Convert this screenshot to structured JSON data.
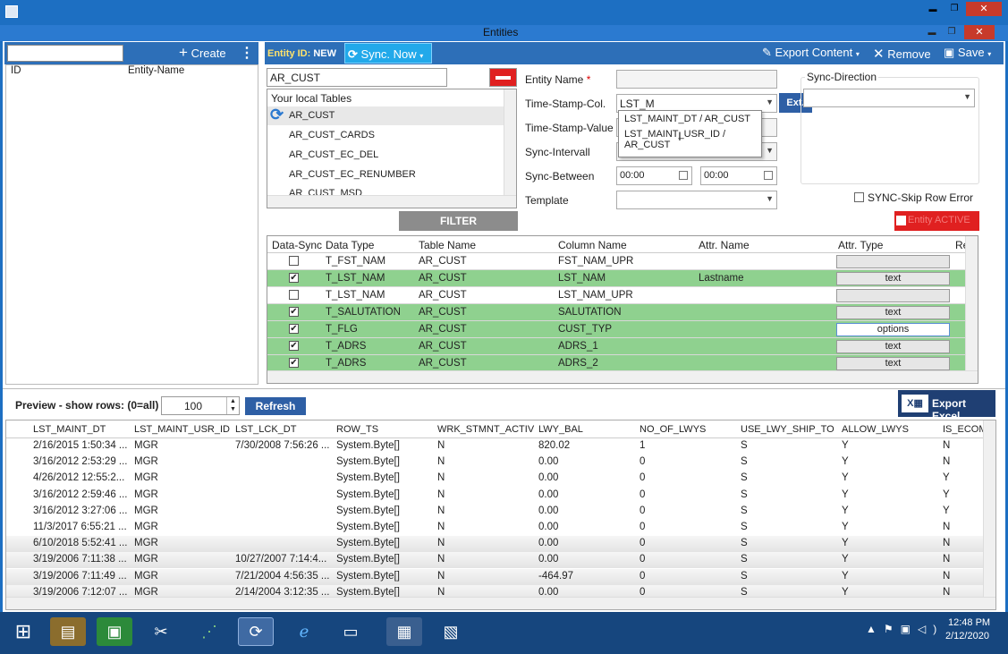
{
  "window": {
    "title": "Entities",
    "min": "▬",
    "restore": "❐",
    "close": "✕"
  },
  "sidebar": {
    "create_label": "Create",
    "col_id": "ID",
    "col_name": "Entity-Name"
  },
  "toolbar": {
    "entity_id_label": "Entity ID:",
    "entity_id_value": "NEW",
    "sync_now_label": "Sync. Now",
    "export_content_label": "Export Content",
    "remove_label": "Remove",
    "save_label": "Save"
  },
  "table_select": {
    "search_value": "AR_CUST",
    "list_header": "Your local Tables",
    "items": [
      "AR_CUST",
      "AR_CUST_CARDS",
      "AR_CUST_EC_DEL",
      "AR_CUST_EC_RENUMBER",
      "AR_CUST_MSD"
    ],
    "filter_label": "FILTER"
  },
  "form": {
    "entity_name_label": "Entity Name",
    "timestamp_col_label": "Time-Stamp-Col.",
    "timestamp_col_value": "LST_M",
    "ext_label": "Ext.",
    "timestamp_value_label": "Time-Stamp-Value",
    "sync_interval_label": "Sync-Intervall",
    "sync_between_label": "Sync-Between",
    "sync_from": "00:00",
    "sync_to": "00:00",
    "template_label": "Template",
    "dropdown_options": [
      "LST_MAINT_DT / AR_CUST",
      "LST_MAINT_USR_ID / AR_CUST"
    ]
  },
  "sync_direction": {
    "label": "Sync-Direction",
    "skip_error_label": "SYNC-Skip Row Error",
    "entity_active_label": "Entity ACTIVE"
  },
  "mapping": {
    "headers": [
      "Data-Sync",
      "Data Type",
      "Table Name",
      "Column Name",
      "Attr. Name",
      "Attr. Type",
      "Re"
    ],
    "rows": [
      {
        "checked": "",
        "type": "T_FST_NAM",
        "table": "AR_CUST",
        "column": "FST_NAM_UPR",
        "attr_name": "",
        "attr_type": ""
      },
      {
        "checked": "✔",
        "type": "T_LST_NAM",
        "table": "AR_CUST",
        "column": "LST_NAM",
        "attr_name": "Lastname",
        "attr_type": "text"
      },
      {
        "checked": "",
        "type": "T_LST_NAM",
        "table": "AR_CUST",
        "column": "LST_NAM_UPR",
        "attr_name": "",
        "attr_type": ""
      },
      {
        "checked": "✔",
        "type": "T_SALUTATION",
        "table": "AR_CUST",
        "column": "SALUTATION",
        "attr_name": "",
        "attr_type": "text"
      },
      {
        "checked": "✔",
        "type": "T_FLG",
        "table": "AR_CUST",
        "column": "CUST_TYP",
        "attr_name": "",
        "attr_type": "options"
      },
      {
        "checked": "✔",
        "type": "T_ADRS",
        "table": "AR_CUST",
        "column": "ADRS_1",
        "attr_name": "",
        "attr_type": "text"
      },
      {
        "checked": "✔",
        "type": "T_ADRS",
        "table": "AR_CUST",
        "column": "ADRS_2",
        "attr_name": "",
        "attr_type": "text"
      }
    ]
  },
  "preview": {
    "label": "Preview - show rows: (0=all)",
    "rows_value": "100",
    "refresh_label": "Refresh",
    "export_excel_label": "Export Excel",
    "headers": [
      "LST_MAINT_DT",
      "LST_MAINT_USR_ID",
      "LST_LCK_DT",
      "ROW_TS",
      "WRK_STMNT_ACTIV",
      "LWY_BAL",
      "NO_OF_LWYS",
      "USE_LWY_SHIP_TO",
      "ALLOW_LWYS",
      "IS_ECOM"
    ],
    "rows": [
      [
        "2/16/2015 1:50:34 ...",
        "MGR",
        "7/30/2008 7:56:26 ...",
        "System.Byte[]",
        "N",
        "820.02",
        "1",
        "S",
        "Y",
        "N"
      ],
      [
        "3/16/2012 2:53:29 ...",
        "MGR",
        "",
        "System.Byte[]",
        "N",
        "0.00",
        "0",
        "S",
        "Y",
        "N"
      ],
      [
        "4/26/2012 12:55:2...",
        "MGR",
        "",
        "System.Byte[]",
        "N",
        "0.00",
        "0",
        "S",
        "Y",
        "Y"
      ],
      [
        "3/16/2012 2:59:46 ...",
        "MGR",
        "",
        "System.Byte[]",
        "N",
        "0.00",
        "0",
        "S",
        "Y",
        "Y"
      ],
      [
        "3/16/2012 3:27:06 ...",
        "MGR",
        "",
        "System.Byte[]",
        "N",
        "0.00",
        "0",
        "S",
        "Y",
        "Y"
      ],
      [
        "11/3/2017 6:55:21 ...",
        "MGR",
        "",
        "System.Byte[]",
        "N",
        "0.00",
        "0",
        "S",
        "Y",
        "N"
      ],
      [
        "6/10/2018 5:52:41 ...",
        "MGR",
        "",
        "System.Byte[]",
        "N",
        "0.00",
        "0",
        "S",
        "Y",
        "N"
      ],
      [
        "3/19/2006 7:11:38 ...",
        "MGR",
        "10/27/2007 7:14:4...",
        "System.Byte[]",
        "N",
        "0.00",
        "0",
        "S",
        "Y",
        "N"
      ],
      [
        "3/19/2006 7:11:49 ...",
        "MGR",
        "7/21/2004 4:56:35 ...",
        "System.Byte[]",
        "N",
        "-464.97",
        "0",
        "S",
        "Y",
        "N"
      ],
      [
        "3/19/2006 7:12:07 ...",
        "MGR",
        "2/14/2004 3:12:35 ...",
        "System.Byte[]",
        "N",
        "0.00",
        "0",
        "S",
        "Y",
        "N"
      ]
    ]
  },
  "taskbar": {
    "time": "12:48 PM",
    "date": "2/12/2020"
  }
}
